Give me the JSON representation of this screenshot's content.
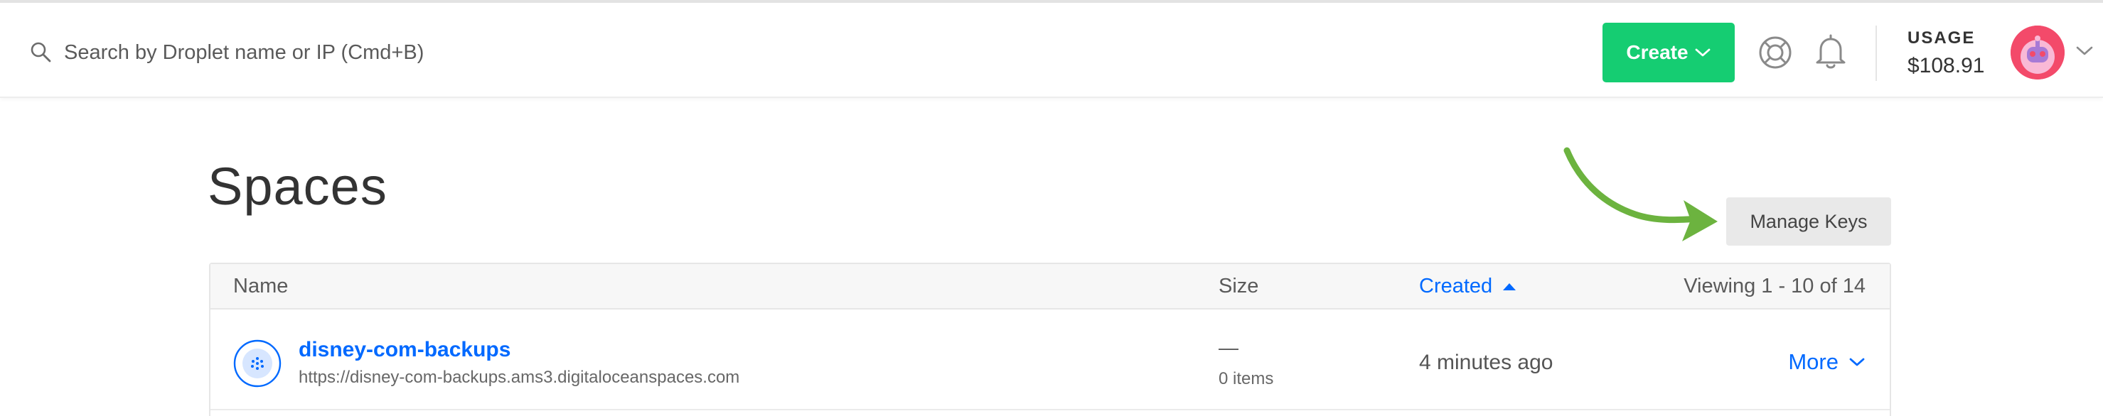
{
  "header": {
    "search": {
      "placeholder": "Search by Droplet name or IP (Cmd+B)",
      "icon": "search-icon"
    },
    "create_label": "Create",
    "help_icon": "lifebuoy-icon",
    "notifications_icon": "bell-icon",
    "usage": {
      "label": "USAGE",
      "value": "$108.91"
    }
  },
  "page": {
    "title": "Spaces",
    "manage_keys_label": "Manage Keys"
  },
  "table": {
    "columns": {
      "name": "Name",
      "size": "Size",
      "created": "Created"
    },
    "sort": {
      "column": "created",
      "direction": "ascending"
    },
    "viewing": "Viewing 1 - 10 of 14",
    "rows": [
      {
        "name": "disney-com-backups",
        "url": "https://disney-com-backups.ams3.digitaloceanspaces.com",
        "size": "—",
        "items": "0 items",
        "created": "4 minutes ago",
        "more_label": "More"
      }
    ]
  },
  "colors": {
    "brand_blue": "#0069ff",
    "create_green": "#15cd72",
    "avatar_red": "#f34a6a",
    "annotation_green": "#6cb33f"
  }
}
